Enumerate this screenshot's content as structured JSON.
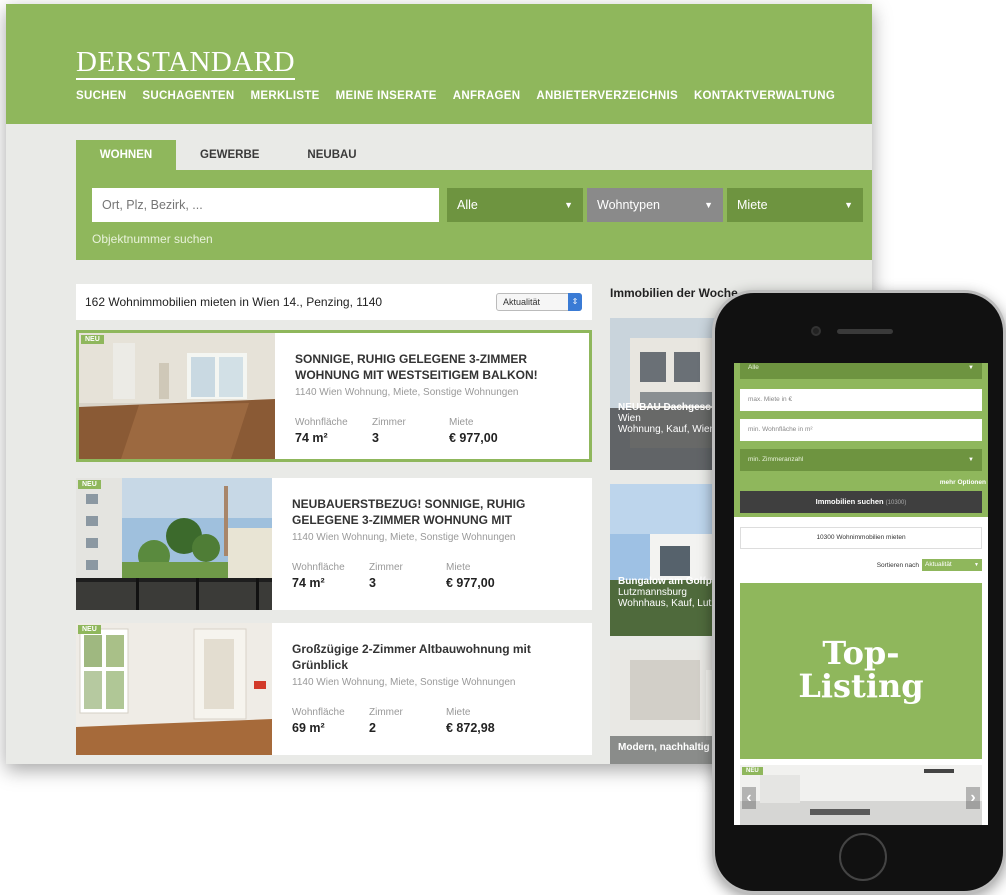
{
  "desktop": {
    "logo": "DERSTANDARD",
    "nav": [
      "SUCHEN",
      "SUCHAGENTEN",
      "MERKLISTE",
      "MEINE INSERATE",
      "ANFRAGEN",
      "ANBIETERVERZEICHNIS",
      "KONTAKTVERWALTUNG"
    ],
    "tabs": [
      "WOHNEN",
      "GEWERBE",
      "NEUBAU"
    ],
    "search": {
      "placeholder": "Ort, Plz, Bezirk, ...",
      "dropdown_1": "Alle",
      "dropdown_2": "Wohntypen",
      "dropdown_3": "Miete",
      "object_number_link": "Objektnummer suchen"
    },
    "results": {
      "summary": "162 Wohnimmobilien mieten in Wien 14., Penzing, 1140",
      "sort": "Aktualität"
    },
    "badge": "NEU",
    "labels": {
      "area": "Wohnfläche",
      "rooms": "Zimmer",
      "rent": "Miete"
    },
    "listings": [
      {
        "title": "SONNIGE, RUHIG GELEGENE 3-ZIMMER WOHNUNG MIT WESTSEITIGEM BALKON!",
        "subtitle": "1140 Wien Wohnung, Miete, Sonstige Wohnungen",
        "area": "74 m²",
        "rooms": "3",
        "rent": "€ 977,00"
      },
      {
        "title": "NEUBAUERSTBEZUG! SONNIGE, RUHIG GELEGENE 3-ZIMMER WOHNUNG MIT",
        "subtitle": "1140 Wien Wohnung, Miete, Sonstige Wohnungen",
        "area": "74 m²",
        "rooms": "3",
        "rent": "€ 977,00"
      },
      {
        "title": "Großzügige 2-Zimmer Altbauwohnung mit Grünblick",
        "subtitle": "1140 Wien Wohnung, Miete, Sonstige Wohnungen",
        "area": "69 m²",
        "rooms": "2",
        "rent": "€ 872,98"
      }
    ],
    "woche": {
      "heading": "Immobilien der Woche",
      "cards": [
        {
          "title": "NEUBAU Dachgesc mit traumhaftem F Top 1/13",
          "place": "Wien",
          "type": "Wohnung, Kauf, Wien"
        },
        {
          "title": "Bungalow am Golfp Therme vom Bautr",
          "place": "Lutzmannsburg",
          "type": "Wohnhaus, Kauf, Lutz"
        },
        {
          "title": "Modern, nachhaltig im Wildgarten",
          "place": "",
          "type": ""
        }
      ]
    }
  },
  "mobile": {
    "top_select": "Alle",
    "max_rent_placeholder": "max. Miete in €",
    "min_area_placeholder": "min. Wohnfläche in m²",
    "min_rooms_select": "min. Zimmeranzahl",
    "more_options": "mehr Optionen",
    "search_button": "Immobilien suchen",
    "search_count": "(10300)",
    "results_count": "10300 Wohnimmobilien mieten",
    "sort_label": "Sortieren nach",
    "sort_value": "Aktualität",
    "top_listing": "Top-\nListing",
    "badge": "NEU"
  },
  "colors": {
    "brand_green": "#8fb75c",
    "dark_green": "#6e9440",
    "page_bg": "#e9eae7"
  }
}
